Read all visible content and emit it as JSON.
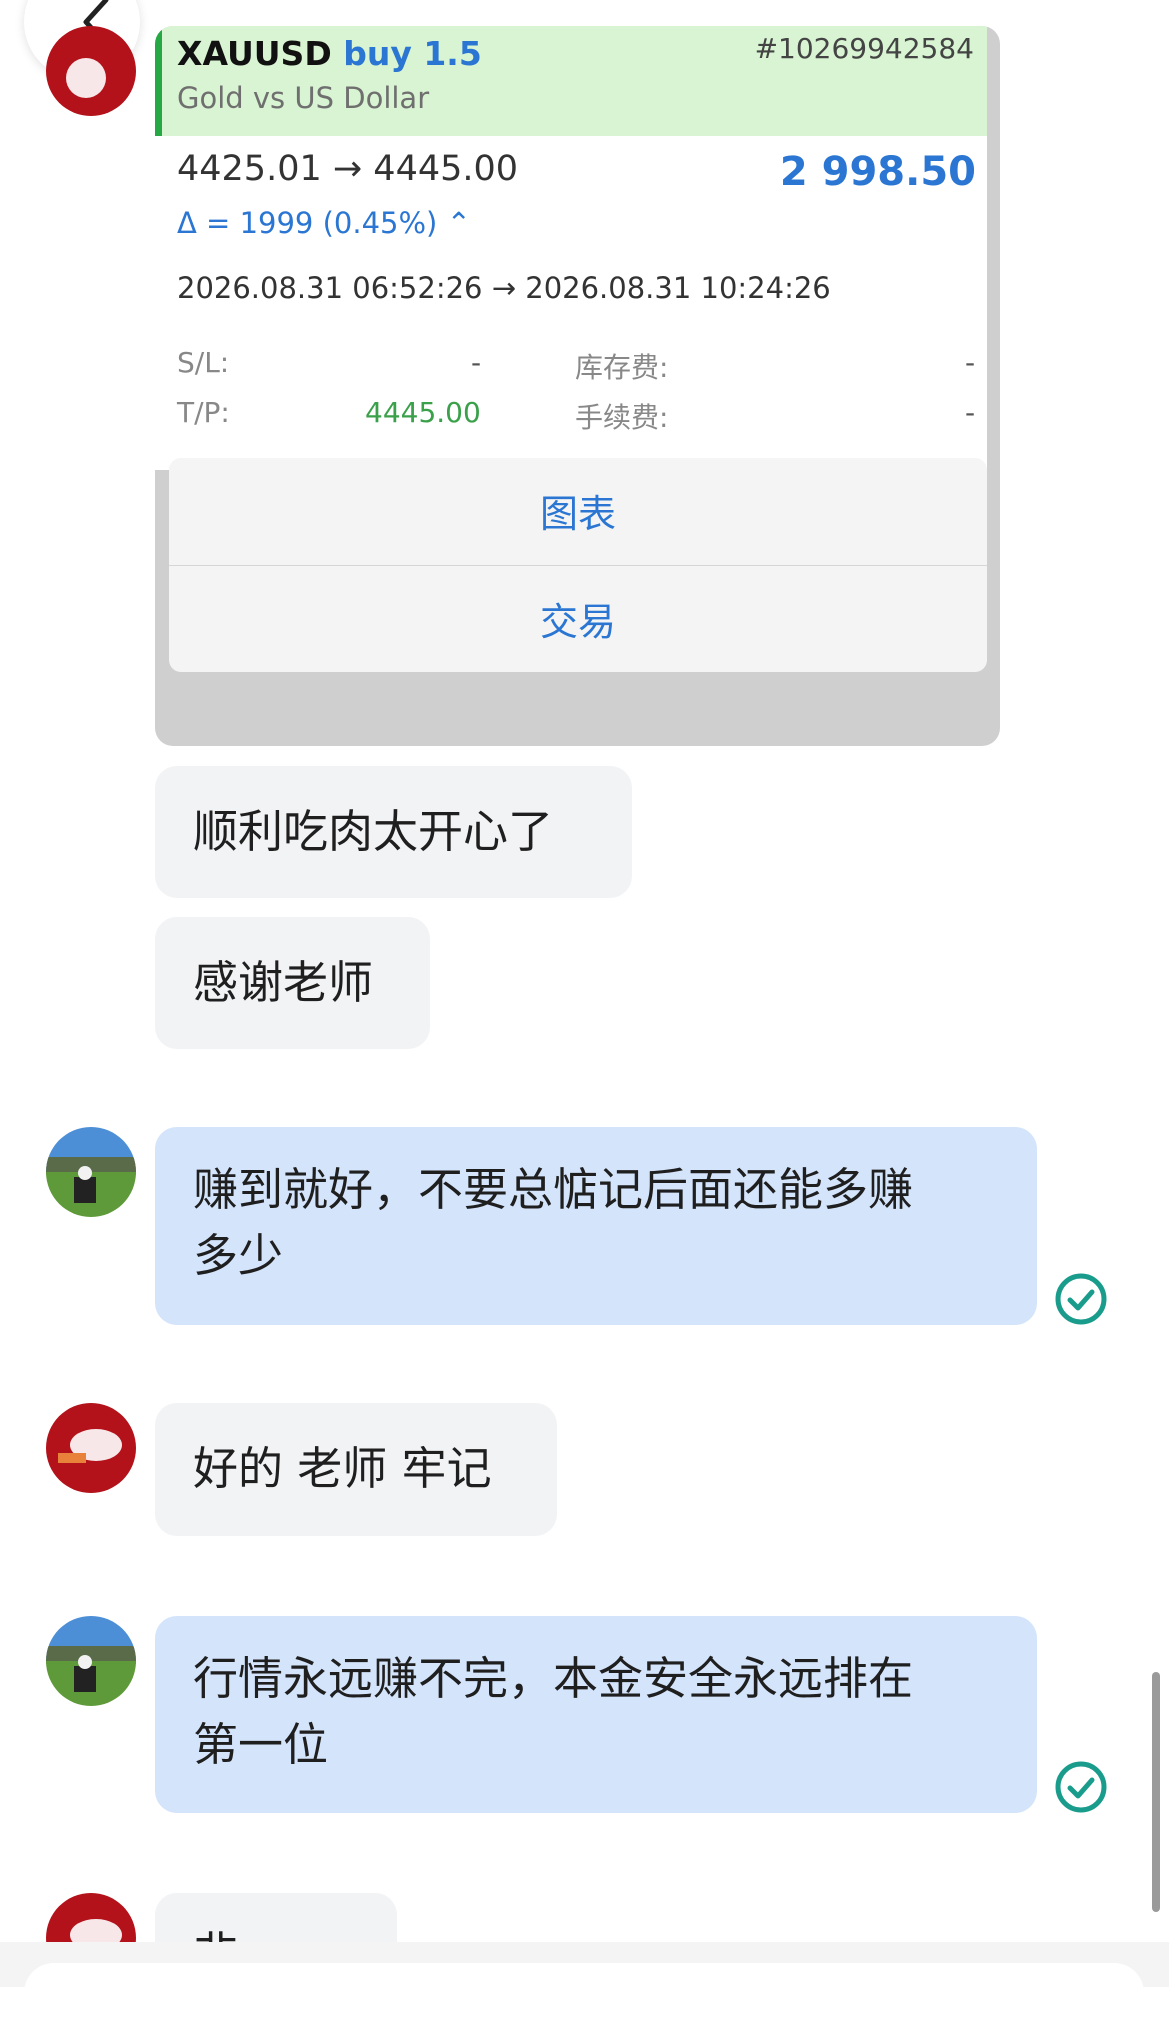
{
  "trade_card": {
    "symbol": "XAUUSD",
    "side": "buy 1.5",
    "ticket": "#10269942584",
    "description": "Gold vs US Dollar",
    "prices": "4425.01 → 4445.00",
    "profit": "2 998.50",
    "delta": "Δ = 1999 (0.45%) ⌃",
    "times": "2026.08.31 06:52:26 → 2026.08.31 10:24:26",
    "sl_label": "S/L:",
    "sl_value": "-",
    "tp_label": "T/P:",
    "tp_value": "4445.00",
    "swap_label": "库存费:",
    "swap_value": "-",
    "commission_label": "手续费:",
    "commission_value": "-",
    "menu_chart": "图表",
    "menu_trade": "交易"
  },
  "messages": [
    {
      "sender": "user",
      "text": "顺利吃肉太开心了"
    },
    {
      "sender": "user",
      "text": "感谢老师"
    },
    {
      "sender": "teacher",
      "line1": "赚到就好，不要总惦记后面还能多赚",
      "line2": "多少",
      "read": true
    },
    {
      "sender": "user",
      "text": "好的 老师 牢记"
    },
    {
      "sender": "teacher",
      "line1": "行情永远赚不完，本金安全永远排在",
      "line2": "第一位",
      "read": true
    },
    {
      "sender": "user",
      "text": "非 ..."
    }
  ],
  "colors": {
    "teacher_bubble": "#d4e4fb",
    "user_bubble": "#f2f3f5",
    "accent_blue": "#2a76d2",
    "positive_green": "#3aa14a",
    "read_check": "#1a9c8c"
  },
  "icons": {
    "back": "chevron-left-icon",
    "read": "check-circle-icon"
  }
}
